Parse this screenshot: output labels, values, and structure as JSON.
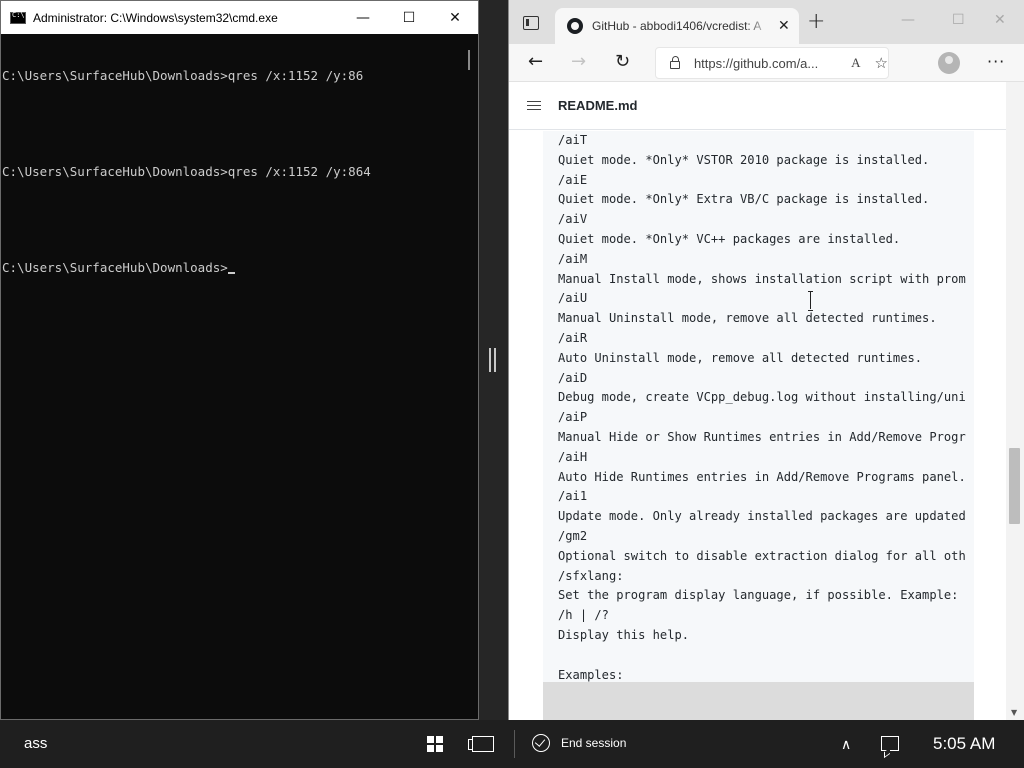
{
  "cmd": {
    "title": "Administrator: C:\\Windows\\system32\\cmd.exe",
    "minimize": "—",
    "maximize": "☐",
    "close": "✕",
    "line1": "C:\\Users\\SurfaceHub\\Downloads>qres /x:1152 /y:86",
    "line2": "C:\\Users\\SurfaceHub\\Downloads>qres /x:1152 /y:864",
    "line3": "C:\\Users\\SurfaceHub\\Downloads>"
  },
  "browser": {
    "tab_title": "GitHub - abbodi1406/vcredist: A",
    "tab_close": "✕",
    "new_tab": "+",
    "minimize": "—",
    "maximize": "☐",
    "close": "✕",
    "back": "←",
    "forward": "→",
    "refresh": "↻",
    "url": "https://github.com/a...",
    "read_aloud": "A",
    "favorite": "☆",
    "more": "···",
    "readme_title": "README.md",
    "code_lines": [
      "/aiT",
      "Quiet mode. *Only* VSTOR 2010 package is installed.",
      "/aiE",
      "Quiet mode. *Only* Extra VB/C package is installed.",
      "/aiV",
      "Quiet mode. *Only* VC++ packages are installed.",
      "/aiM",
      "Manual Install mode, shows installation script with prom",
      "/aiU",
      "Manual Uninstall mode, remove all detected runtimes.",
      "/aiR",
      "Auto Uninstall mode, remove all detected runtimes.",
      "/aiD",
      "Debug mode, create VCpp_debug.log without installing/uni",
      "/aiP",
      "Manual Hide or Show Runtimes entries in Add/Remove Progr",
      "/aiH",
      "Auto Hide Runtimes entries in Add/Remove Programs panel.",
      "/ai1",
      "Update mode. Only already installed packages are updated",
      "/gm2",
      "Optional switch to disable extraction dialog for all oth",
      "/sfxlang:",
      "Set the program display language, if possible. Example:",
      "/h | /?",
      "Display this help.",
      "",
      "Examples:"
    ]
  },
  "taskbar": {
    "search_text": "ass",
    "end_session": "End session",
    "chevron": "∧",
    "clock": "5:05 AM"
  }
}
